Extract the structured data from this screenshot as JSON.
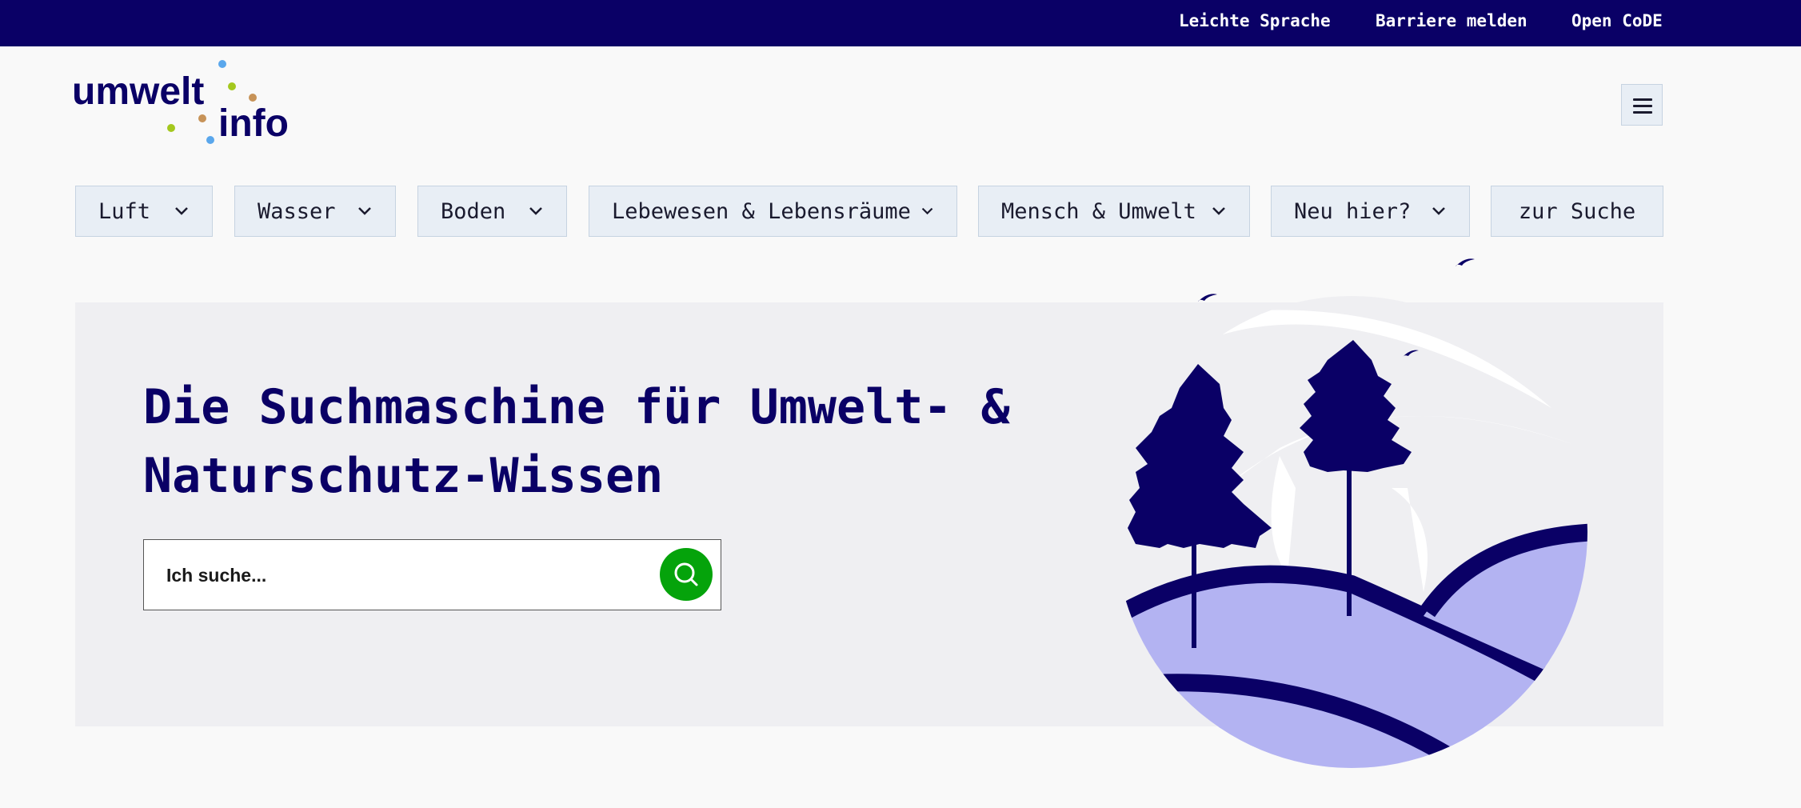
{
  "topbar": {
    "links": [
      "Leichte Sprache",
      "Barriere melden",
      "Open CoDE"
    ]
  },
  "logo": {
    "line1": "umwelt",
    "line2": "info"
  },
  "nav": {
    "items": [
      {
        "label": "Luft"
      },
      {
        "label": "Wasser"
      },
      {
        "label": "Boden"
      },
      {
        "label": "Lebewesen & Lebensräume"
      },
      {
        "label": "Mensch & Umwelt"
      },
      {
        "label": "Neu hier?"
      },
      {
        "label": "zur Suche"
      }
    ]
  },
  "hero": {
    "title_line1": "Die Suchmaschine für Umwelt- &",
    "title_line2": "Naturschutz-Wissen",
    "search_placeholder": "Ich suche..."
  },
  "colors": {
    "brand_navy": "#0a0066",
    "nav_bg": "#e8eef5",
    "search_green": "#05a30b",
    "hill_light": "#b3b3f2"
  },
  "icons": [
    "chevron-down-icon",
    "menu-icon",
    "search-icon",
    "bird-icon",
    "tree-icon"
  ]
}
